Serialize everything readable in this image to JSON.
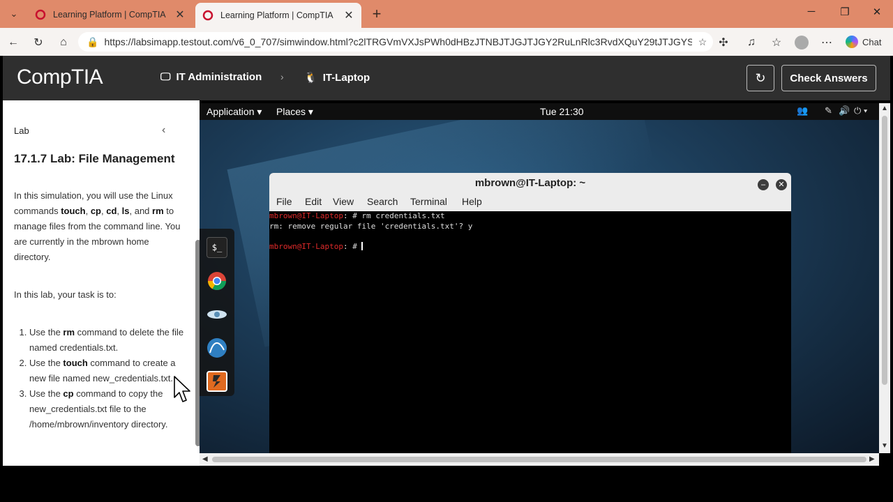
{
  "browser": {
    "tabs": [
      {
        "title": "Learning Platform | CompTIA",
        "active": false
      },
      {
        "title": "Learning Platform | CompTIA",
        "active": true
      }
    ],
    "url": "https://labsimapp.testout.com/v6_0_707/simwindow.html?c2lTRGVmVXJsPWh0dHBzJTNBJTJGJTJGY2RuLnRlc3RvdXQuY29tJTJGYS1wb...",
    "chat_label": "Chat",
    "accent_color": "#e08a6a"
  },
  "app_header": {
    "logo": "CompTIA",
    "breadcrumb": [
      "IT Administration",
      "IT-Laptop"
    ],
    "check_answers_label": "Check Answers"
  },
  "lab_panel": {
    "section_label": "Lab",
    "title": "17.1.7 Lab: File Management",
    "intro_parts": [
      "In this simulation, you will use the Linux commands ",
      "touch",
      ", ",
      "cp",
      ", ",
      "cd",
      ", ",
      "ls",
      ", and ",
      "rm",
      " to manage files from the command line. You are currently in the mbrown home directory."
    ],
    "task_intro": "In this lab, your task is to:",
    "tasks": [
      {
        "pre": "Use the ",
        "cmd": "rm",
        "post": " command to delete the file named credentials.txt."
      },
      {
        "pre": "Use the ",
        "cmd": "touch",
        "post": " command to create a new file named new_credentials.txt."
      },
      {
        "pre": "Use the ",
        "cmd": "cp",
        "post": " command to copy the new_credentials.txt file to the /home/mbrown/inventory directory."
      }
    ]
  },
  "desktop": {
    "top_bar": {
      "application_menu": "Application ▾",
      "places_menu": "Places ▾",
      "clock": "Tue 21:30"
    },
    "dock_icons": [
      "terminal-icon",
      "chrome-icon",
      "eye-icon",
      "network-icon",
      "app-icon"
    ]
  },
  "terminal": {
    "title": "mbrown@IT-Laptop: ~",
    "menu": [
      "File",
      "Edit",
      "View",
      "Search",
      "Terminal",
      "Help"
    ],
    "lines": [
      {
        "user": "mbrown@IT-Laptop",
        "rest": ": # rm credentials.txt"
      },
      {
        "user": "",
        "rest": "rm: remove regular file 'credentials.txt'? y"
      },
      {
        "user": "",
        "rest": ""
      },
      {
        "user": "mbrown@IT-Laptop",
        "rest": ": # "
      }
    ]
  }
}
